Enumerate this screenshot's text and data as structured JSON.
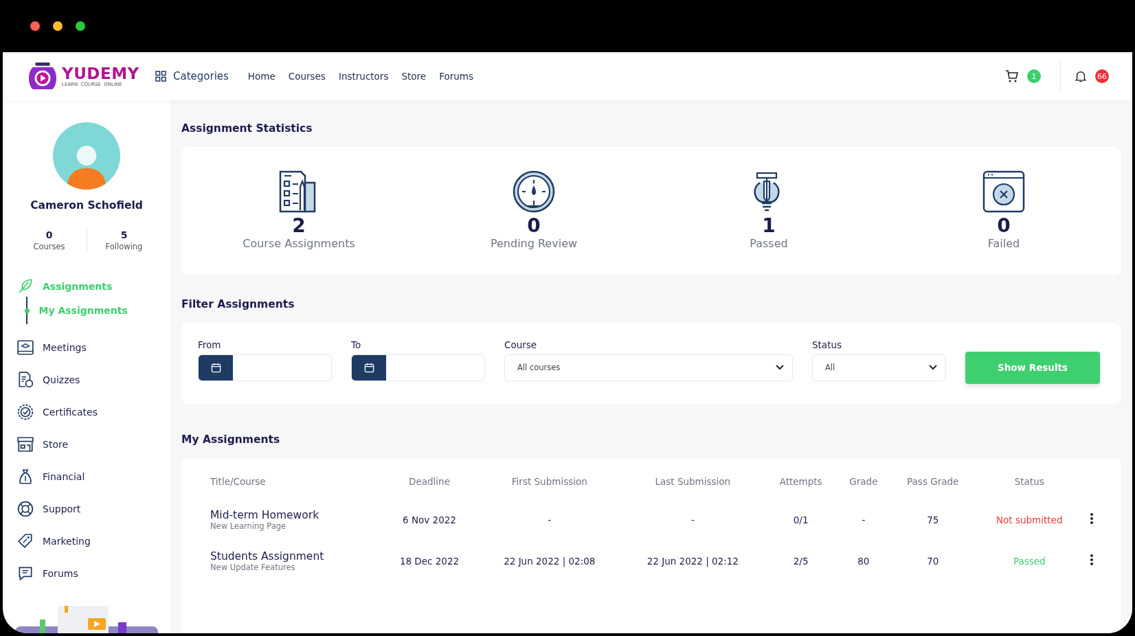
{
  "logo": {
    "name": "YUDEMY",
    "tagline": "LEARN  COURSE  ONLINE"
  },
  "header": {
    "categories": "Categories",
    "nav": [
      "Home",
      "Courses",
      "Instructors",
      "Store",
      "Forums"
    ],
    "cart_count": "1",
    "notification_count": "66"
  },
  "profile": {
    "name": "Cameron Schofield",
    "stats": [
      {
        "value": "0",
        "label": "Courses"
      },
      {
        "value": "5",
        "label": "Following"
      }
    ]
  },
  "sidebar": {
    "items": [
      {
        "label": "Assignments",
        "kind": "feather",
        "selected": true,
        "expanded": true,
        "children": [
          {
            "label": "My Assignments",
            "selected": true
          }
        ]
      },
      {
        "label": "Meetings",
        "kind": "board",
        "selected": false
      },
      {
        "label": "Quizzes",
        "kind": "quiz",
        "selected": false
      },
      {
        "label": "Certificates",
        "kind": "badge",
        "selected": false
      },
      {
        "label": "Store",
        "kind": "store",
        "selected": false
      },
      {
        "label": "Financial",
        "kind": "bag",
        "selected": false
      },
      {
        "label": "Support",
        "kind": "ring",
        "selected": false
      },
      {
        "label": "Marketing",
        "kind": "tag",
        "selected": false
      },
      {
        "label": "Forums",
        "kind": "chat",
        "selected": false
      }
    ]
  },
  "statistics": {
    "title": "Assignment Statistics",
    "items": [
      {
        "kind": "sheet",
        "value": "2",
        "label": "Course Assignments"
      },
      {
        "kind": "gauge",
        "value": "0",
        "label": "Pending Review"
      },
      {
        "kind": "bulb",
        "value": "1",
        "label": "Passed"
      },
      {
        "kind": "failbox",
        "value": "0",
        "label": "Failed"
      }
    ]
  },
  "filter": {
    "title": "Filter Assignments",
    "from_label": "From",
    "to_label": "To",
    "course_label": "Course",
    "course_value": "All courses",
    "status_label": "Status",
    "status_value": "All",
    "button": "Show Results"
  },
  "table": {
    "title": "My Assignments",
    "columns": [
      "Title/Course",
      "Deadline",
      "First Submission",
      "Last Submission",
      "Attempts",
      "Grade",
      "Pass Grade",
      "Status"
    ],
    "rows": [
      {
        "title": "Mid-term Homework",
        "course": "New Learning Page",
        "deadline": "6 Nov 2022",
        "first": "-",
        "last": "-",
        "attempts": "0/1",
        "grade": "-",
        "pass_grade": "75",
        "status": "Not submitted",
        "kind": "failed"
      },
      {
        "title": "Students Assignment",
        "course": "New Update Features",
        "deadline": "18 Dec 2022",
        "first": "22 Jun 2022 | 02:08",
        "last": "22 Jun 2022 | 02:12",
        "attempts": "2/5",
        "grade": "80",
        "pass_grade": "70",
        "status": "Passed",
        "kind": "passed"
      }
    ]
  }
}
